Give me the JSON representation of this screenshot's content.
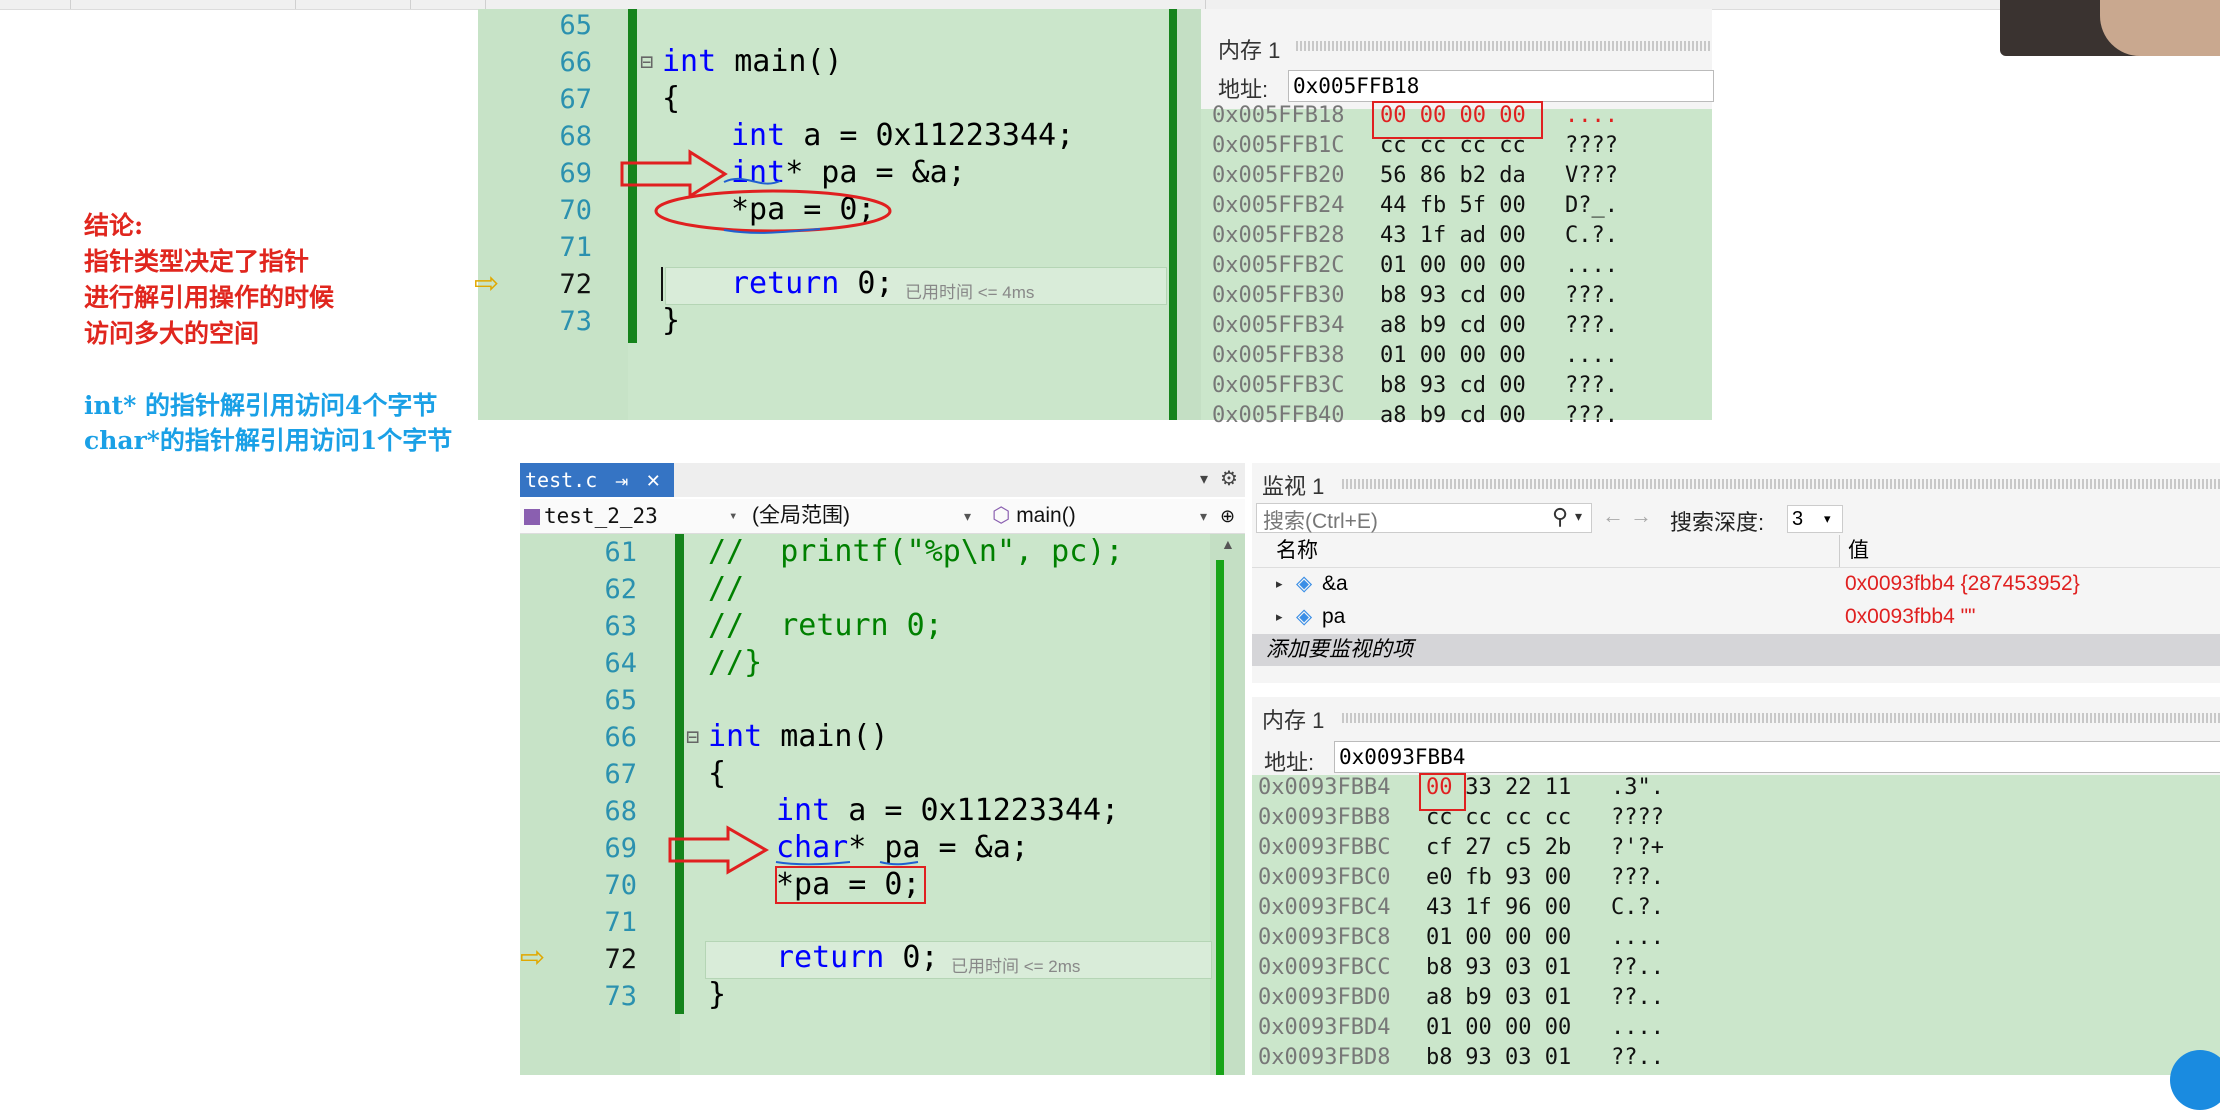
{
  "notes": {
    "conclusion_title": "结论:",
    "conclusion_lines": [
      "指针类型决定了指针",
      "进行解引用操作的时候",
      "访问多大的空间"
    ],
    "int_line": "int* 的指针解引用访问4个字节",
    "char_line": "char*的指针解引用访问1个字节"
  },
  "top_editor": {
    "line_numbers": [
      "65",
      "66",
      "67",
      "68",
      "69",
      "70",
      "71",
      "72",
      "73"
    ],
    "lines": {
      "main_kw": "int",
      "main_rest": " main()",
      "open_brace": "{",
      "decl_kw": "int",
      "decl_rest": " a = 0x11223344;",
      "ptr_kw": "int",
      "ptr_rest": "* pa = &a;",
      "deref": "*pa = 0;",
      "ret_kw": "return",
      "ret_rest": " 0;",
      "close_brace": "}"
    },
    "elapsed_hint": "已用时间 <= 4ms",
    "collapse_glyph": "⊟"
  },
  "top_memory": {
    "title": "内存 1",
    "address_label": "地址:",
    "address_value": "0x005FFB18",
    "rows": [
      {
        "addr": "0x005FFB18",
        "bytes": "00 00 00 00",
        "ascii": "....",
        "changed": true
      },
      {
        "addr": "0x005FFB1C",
        "bytes": "cc cc cc cc",
        "ascii": "????"
      },
      {
        "addr": "0x005FFB20",
        "bytes": "56 86 b2 da",
        "ascii": "V???"
      },
      {
        "addr": "0x005FFB24",
        "bytes": "44 fb 5f 00",
        "ascii": "D?_."
      },
      {
        "addr": "0x005FFB28",
        "bytes": "43 1f ad 00",
        "ascii": "C.?."
      },
      {
        "addr": "0x005FFB2C",
        "bytes": "01 00 00 00",
        "ascii": "...."
      },
      {
        "addr": "0x005FFB30",
        "bytes": "b8 93 cd 00",
        "ascii": "???."
      },
      {
        "addr": "0x005FFB34",
        "bytes": "a8 b9 cd 00",
        "ascii": "???."
      },
      {
        "addr": "0x005FFB38",
        "bytes": "01 00 00 00",
        "ascii": "...."
      },
      {
        "addr": "0x005FFB3C",
        "bytes": "b8 93 cd 00",
        "ascii": "???."
      },
      {
        "addr": "0x005FFB40",
        "bytes": "a8 b9 cd 00",
        "ascii": "???."
      }
    ]
  },
  "bottom_editor": {
    "tab_label": "test.c",
    "tab_pin": "⇥",
    "tab_close": "✕",
    "project": "test_2_23",
    "scope": "(全局范围)",
    "function": "main()",
    "line_numbers": [
      "61",
      "62",
      "63",
      "64",
      "65",
      "66",
      "67",
      "68",
      "69",
      "70",
      "71",
      "72",
      "73"
    ],
    "lines": {
      "c61": "//  printf(\"%p\\n\", pc);",
      "c62": "//",
      "c63": "//  return 0;",
      "c64": "//}",
      "main_kw": "int",
      "main_rest": " main()",
      "open_brace": "{",
      "decl_kw": "int",
      "decl_rest": " a = 0x11223344;",
      "ptr_kw": "char",
      "ptr_rest": "* pa = &a;",
      "deref": "*pa = 0;",
      "ret_kw": "return",
      "ret_rest": " 0;",
      "close_brace": "}"
    },
    "elapsed_hint": "已用时间 <= 2ms",
    "collapse_glyph": "⊟"
  },
  "watch": {
    "title": "监视 1",
    "search_placeholder": "搜索(Ctrl+E)",
    "search_depth_label": "搜索深度:",
    "search_depth_value": "3",
    "col_name": "名称",
    "col_value": "值",
    "items": [
      {
        "name": "&a",
        "value": "0x0093fbb4 {287453952}"
      },
      {
        "name": "pa",
        "value": "0x0093fbb4 \"\""
      }
    ],
    "add_item": "添加要监视的项"
  },
  "bottom_memory": {
    "title": "内存 1",
    "address_label": "地址:",
    "address_value": "0x0093FBB4",
    "rows": [
      {
        "addr": "0x0093FBB4",
        "b0": "00",
        "rest": " 33 22 11",
        "ascii": ".3\"."
      },
      {
        "addr": "0x0093FBB8",
        "b0": "cc",
        "rest": " cc cc cc",
        "ascii": "????"
      },
      {
        "addr": "0x0093FBBC",
        "b0": "cf",
        "rest": " 27 c5 2b",
        "ascii": "?'?+"
      },
      {
        "addr": "0x0093FBC0",
        "b0": "e0",
        "rest": " fb 93 00",
        "ascii": "???."
      },
      {
        "addr": "0x0093FBC4",
        "b0": "43",
        "rest": " 1f 96 00",
        "ascii": "C.?."
      },
      {
        "addr": "0x0093FBC8",
        "b0": "01",
        "rest": " 00 00 00",
        "ascii": "...."
      },
      {
        "addr": "0x0093FBCC",
        "b0": "b8",
        "rest": " 93 03 01",
        "ascii": "??.."
      },
      {
        "addr": "0x0093FBD0",
        "b0": "a8",
        "rest": " b9 03 01",
        "ascii": "??.."
      },
      {
        "addr": "0x0093FBD4",
        "b0": "01",
        "rest": " 00 00 00",
        "ascii": "...."
      },
      {
        "addr": "0x0093FBD8",
        "b0": "b8",
        "rest": " 93 03 01",
        "ascii": "??.."
      }
    ]
  },
  "icons": {
    "breakpoint_arrow": "⇨",
    "search": "⚲",
    "back": "←",
    "forward": "→",
    "dropdown": "▾",
    "expand": "▸",
    "settings": "⚙",
    "pin": "⇥"
  },
  "colors": {
    "editor_bg": "#cbe6cb",
    "annotation_red": "#e02020",
    "note_red": "#e0261e",
    "note_blue": "#1aa0e6",
    "keyword_blue": "#0000ff",
    "comment_green": "#008000",
    "tab_active": "#3574c4"
  }
}
